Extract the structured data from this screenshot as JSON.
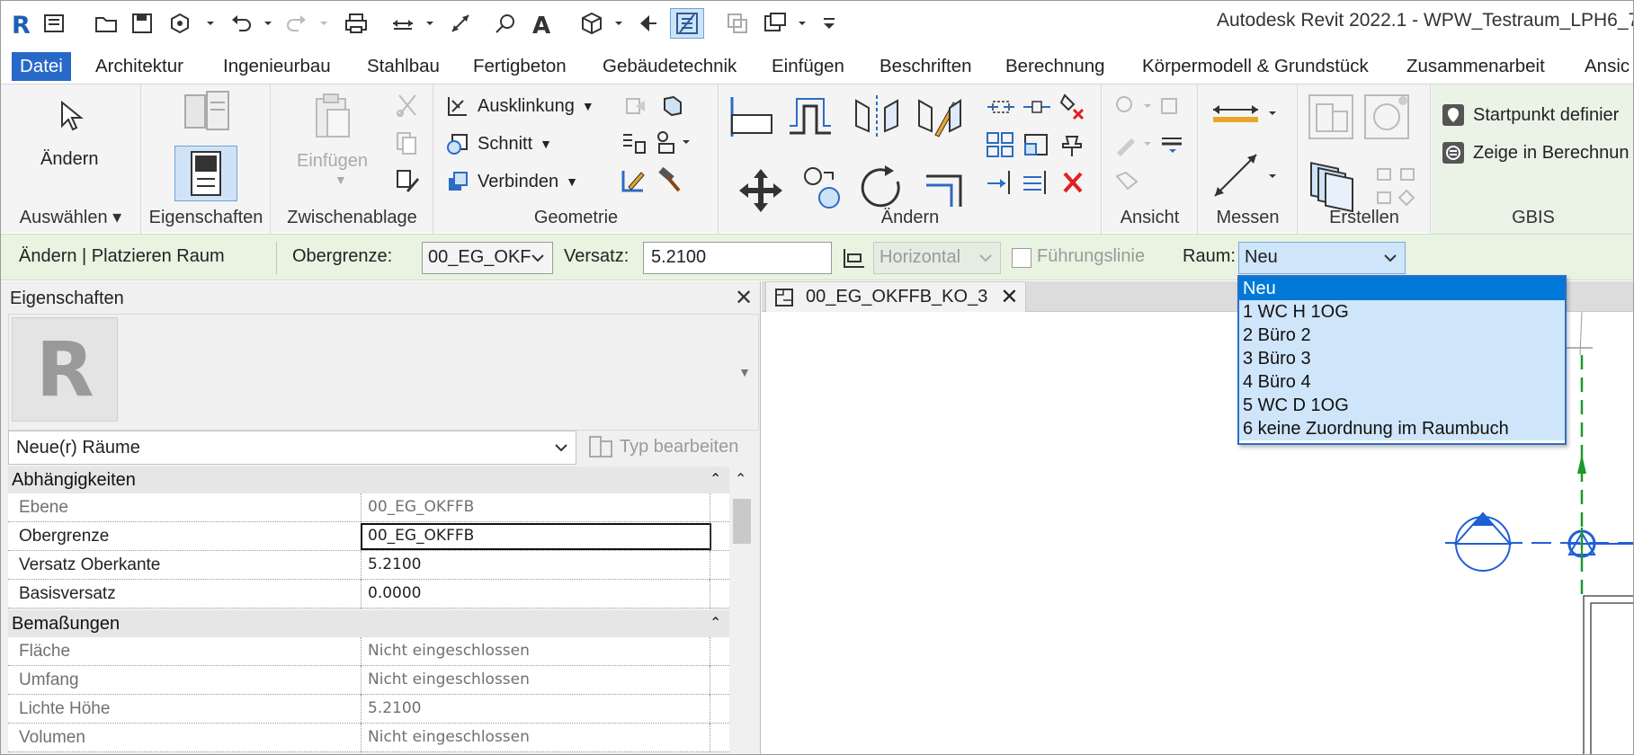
{
  "title": "Autodesk Revit 2022.1 - WPW_Testraum_LPH6_7_",
  "menu": [
    "Datei",
    "Architektur",
    "Ingenieurbau",
    "Stahlbau",
    "Fertigbeton",
    "Gebäudetechnik",
    "Einfügen",
    "Beschriften",
    "Berechnung",
    "Körpermodell & Grundstück",
    "Zusammenarbeit",
    "Ansic"
  ],
  "ribbon": {
    "auswaehlen": {
      "label": "Auswählen",
      "aendern": "Ändern"
    },
    "eigenschaften": {
      "label": "Eigenschaften"
    },
    "zwischenablage": {
      "label": "Zwischenablage",
      "einfuegen": "Einfügen"
    },
    "geometrie": {
      "label": "Geometrie",
      "ausklinkung": "Ausklinkung",
      "schnitt": "Schnitt",
      "verbinden": "Verbinden"
    },
    "aendern": {
      "label": "Ändern"
    },
    "ansicht": {
      "label": "Ansicht"
    },
    "messen": {
      "label": "Messen"
    },
    "erstellen": {
      "label": "Erstellen"
    },
    "gbis": {
      "label": "GBIS",
      "startpunkt": "Startpunkt definier",
      "zeige": "Zeige in Berechnun"
    }
  },
  "optionbar": {
    "context": "Ändern | Platzieren Raum",
    "obergrenze_label": "Obergrenze:",
    "obergrenze_value": "00_EG_OKF",
    "versatz_label": "Versatz:",
    "versatz_value": "5.2100",
    "orientation": "Horizontal",
    "fuehrungslinie": "Führungslinie",
    "raum_label": "Raum:",
    "raum_value": "Neu"
  },
  "room_options": [
    "Neu",
    "1  WC H 1OG",
    "2  Büro 2",
    "3  Büro 3",
    "4  Büro 4",
    "5  WC D 1OG",
    "6  keine Zuordnung im Raumbuch"
  ],
  "properties": {
    "title": "Eigenschaften",
    "type": "Neue(r) Räume",
    "edit_type": "Typ bearbeiten",
    "groups": {
      "abhaengigkeiten": "Abhängigkeiten",
      "bemassungen": "Bemaßungen"
    },
    "rows": {
      "ebene": {
        "key": "Ebene",
        "value": "00_EG_OKFFB"
      },
      "obergrenze": {
        "key": "Obergrenze",
        "value": "00_EG_OKFFB"
      },
      "versatz_oberkante": {
        "key": "Versatz Oberkante",
        "value": "5.2100"
      },
      "basisversatz": {
        "key": "Basisversatz",
        "value": "0.0000"
      },
      "flaeche": {
        "key": "Fläche",
        "value": "Nicht eingeschlossen"
      },
      "umfang": {
        "key": "Umfang",
        "value": "Nicht eingeschlossen"
      },
      "lichte_hoehe": {
        "key": "Lichte Höhe",
        "value": "5.2100"
      },
      "volumen": {
        "key": "Volumen",
        "value": "Nicht eingeschlossen"
      }
    }
  },
  "view": {
    "tab": "00_EG_OKFFB_KO_3"
  },
  "colors": {
    "accent": "#2869c8",
    "optionbar": "#e8f3e1",
    "dropdown_selected": "#0078d7",
    "dropdown_highlight": "#cfe5fa",
    "ref_line": "#1a9a2a",
    "marker": "#1f5fd6"
  }
}
